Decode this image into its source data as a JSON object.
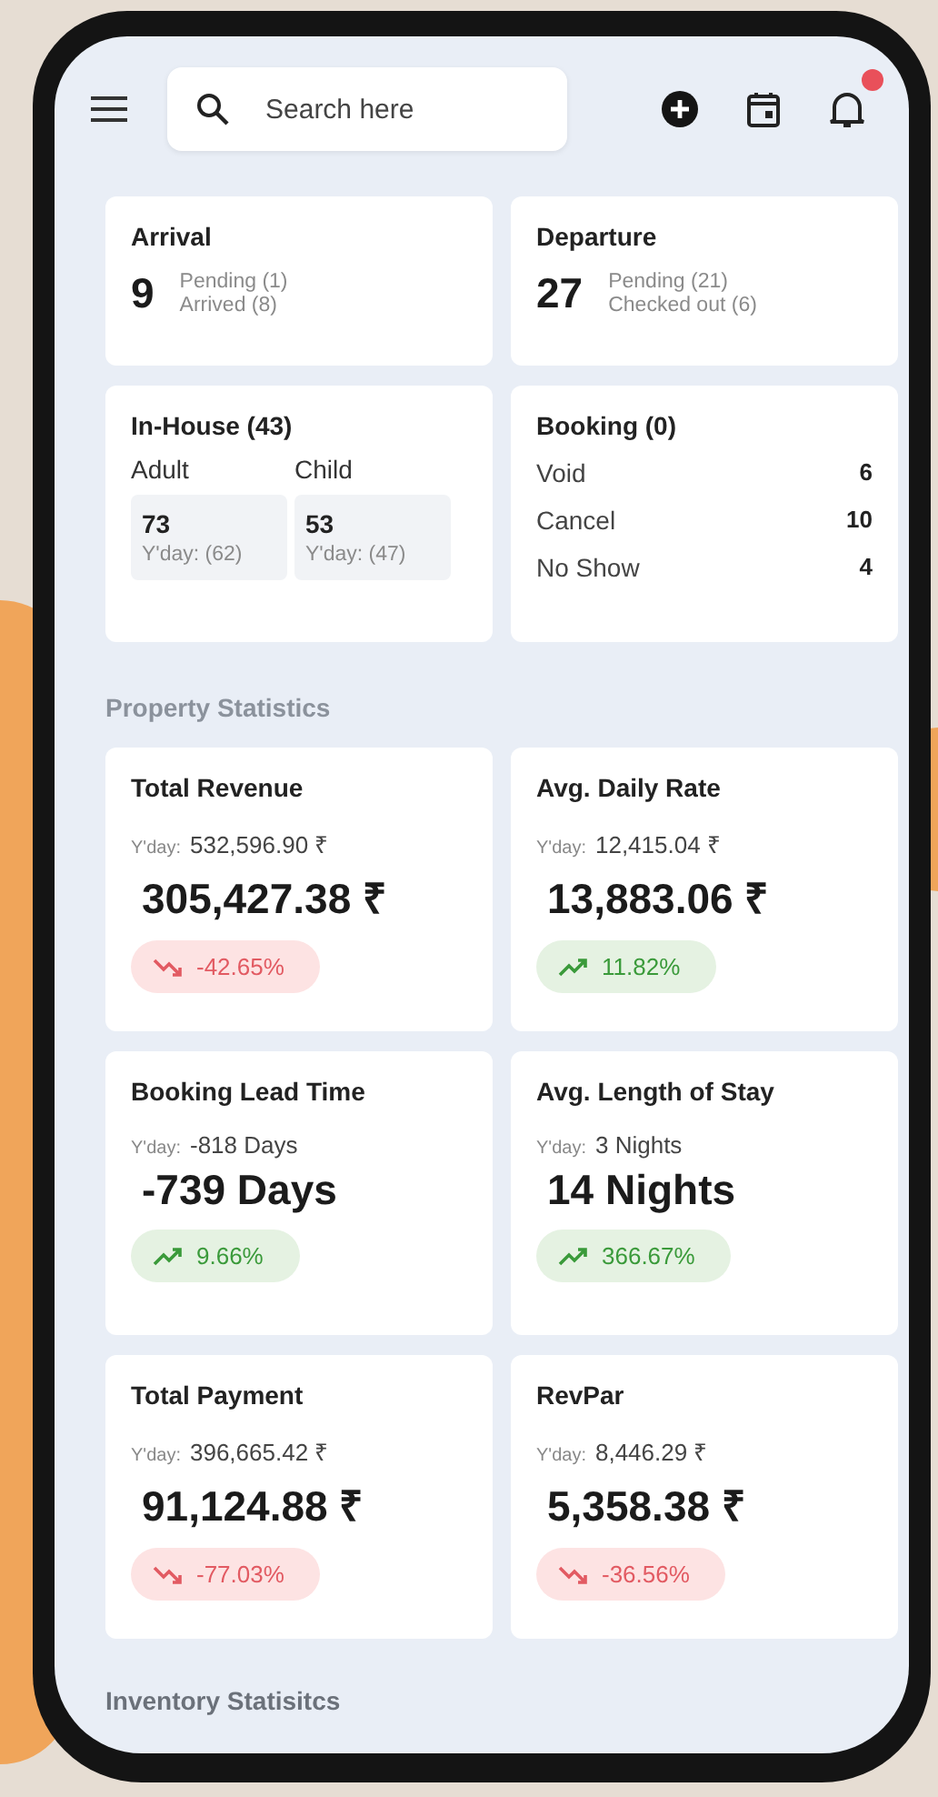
{
  "top_bar": {
    "search": {
      "placeholder": "Search here"
    },
    "notification_badge": true
  },
  "arrival": {
    "title": "Arrival",
    "count": "9",
    "lines": [
      "Pending (1)",
      "Arrived (8)"
    ]
  },
  "departure": {
    "title": "Departure",
    "count": "27",
    "lines": [
      "Pending (21)",
      "Checked out (6)"
    ]
  },
  "in_house": {
    "title": "In-House (43)",
    "groups": [
      {
        "label": "Adult",
        "value": "73",
        "yday": "Y'day: (62)"
      },
      {
        "label": "Child",
        "value": "53",
        "yday": "Y'day: (47)"
      }
    ]
  },
  "booking": {
    "title": "Booking (0)",
    "rows": [
      {
        "label": "Void",
        "value": "6"
      },
      {
        "label": "Cancel",
        "value": "10"
      },
      {
        "label": "No Show",
        "value": "4"
      }
    ]
  },
  "property_statistics": {
    "heading": "Property Statistics",
    "cards": [
      {
        "title": "Total Revenue",
        "yday_label": "Y'day:",
        "yday_value": "532,596.90 ₹",
        "value": "305,427.38 ₹",
        "change": "-42.65%",
        "kind": "down"
      },
      {
        "title": "Avg. Daily Rate",
        "yday_label": "Y'day:",
        "yday_value": "12,415.04 ₹",
        "value": "13,883.06 ₹",
        "change": "11.82%",
        "kind": "up"
      },
      {
        "title": "Booking Lead Time",
        "yday_label": "Y'day:",
        "yday_value": "-818 Days",
        "value": "-739 Days",
        "change": "9.66%",
        "kind": "up"
      },
      {
        "title": "Avg. Length of Stay",
        "yday_label": "Y'day:",
        "yday_value": "3 Nights",
        "value": "14 Nights",
        "change": "366.67%",
        "kind": "up"
      },
      {
        "title": "Total Payment",
        "yday_label": "Y'day:",
        "yday_value": "396,665.42 ₹",
        "value": "91,124.88 ₹",
        "change": "-77.03%",
        "kind": "down"
      },
      {
        "title": "RevPar",
        "yday_label": "Y'day:",
        "yday_value": "8,446.29 ₹",
        "value": "5,358.38 ₹",
        "change": "-36.56%",
        "kind": "down"
      }
    ]
  },
  "inventory_statistics": {
    "heading": "Inventory Statisitcs"
  }
}
